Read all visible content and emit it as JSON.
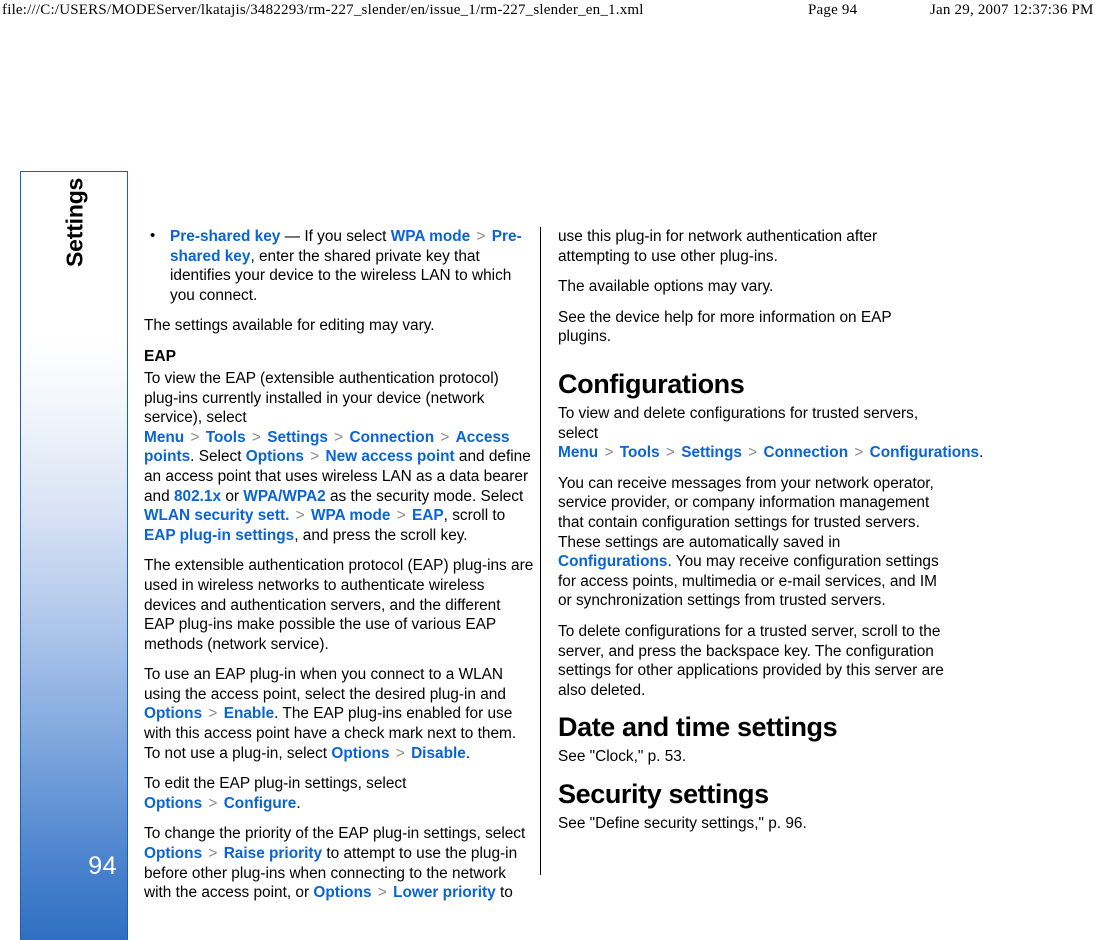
{
  "print_header": {
    "url": "file:///C:/USERS/MODEServer/lkatajis/3482293/rm-227_slender/en/issue_1/rm-227_slender_en_1.xml",
    "page_label": "Page 94",
    "timestamp": "Jan 29, 2007 12:37:36 PM"
  },
  "chapter_tab": {
    "label": "Settings",
    "page_number": "94",
    "border_color": "#1a5fa8",
    "gradient_bottom_color": "#2f6fc2"
  },
  "colors": {
    "link_blue": "#0a64d4",
    "arrow_grey": "#8b8b8b",
    "text_black": "#000000"
  },
  "left_column": {
    "bullet_items": [
      {
        "segments": [
          {
            "t": "Pre-shared key",
            "s": "ui"
          },
          {
            "t": " — If you select ",
            "s": "plain"
          },
          {
            "t": "WPA mode",
            "s": "ui"
          },
          {
            "t": ">",
            "s": "arrow"
          },
          {
            "t": "Pre-shared key",
            "s": "ui"
          },
          {
            "t": ", enter the shared private key that identifies your device to the wireless LAN to which you connect.",
            "s": "plain"
          }
        ]
      }
    ],
    "paragraph_1": "The settings available for editing may vary.",
    "heading_eap": "EAP",
    "paragraph_eap_1": {
      "segments": [
        {
          "t": "To view the EAP (extensible authentication protocol) plug-ins currently installed in your device (network service), select ",
          "s": "plain"
        },
        {
          "t": "Menu",
          "s": "ui"
        },
        {
          "t": ">",
          "s": "arrow"
        },
        {
          "t": "Tools",
          "s": "ui"
        },
        {
          "t": ">",
          "s": "arrow"
        },
        {
          "t": "Settings",
          "s": "ui"
        },
        {
          "t": ">",
          "s": "arrow"
        },
        {
          "t": "Connection",
          "s": "ui"
        },
        {
          "t": ">",
          "s": "arrow"
        },
        {
          "t": "Access points",
          "s": "ui"
        },
        {
          "t": ". Select ",
          "s": "plain"
        },
        {
          "t": "Options",
          "s": "ui"
        },
        {
          "t": ">",
          "s": "arrow"
        },
        {
          "t": "New access point",
          "s": "ui"
        },
        {
          "t": " and define an access point that uses wireless LAN as a data bearer and ",
          "s": "plain"
        },
        {
          "t": "802.1x",
          "s": "ui"
        },
        {
          "t": " or ",
          "s": "plain"
        },
        {
          "t": "WPA/WPA2",
          "s": "ui"
        },
        {
          "t": " as the security mode. Select ",
          "s": "plain"
        },
        {
          "t": "WLAN security sett.",
          "s": "ui"
        },
        {
          "t": ">",
          "s": "arrow"
        },
        {
          "t": "WPA mode",
          "s": "ui"
        },
        {
          "t": ">",
          "s": "arrow"
        },
        {
          "t": "EAP",
          "s": "ui"
        },
        {
          "t": ", scroll to ",
          "s": "plain"
        },
        {
          "t": "EAP plug-in settings",
          "s": "ui"
        },
        {
          "t": ", and press the scroll key.",
          "s": "plain"
        }
      ]
    },
    "paragraph_eap_2": "The extensible authentication protocol (EAP) plug-ins are used in wireless networks to authenticate wireless devices and authentication servers, and the different EAP plug-ins make possible the use of various EAP methods (network service).",
    "paragraph_eap_3": {
      "segments": [
        {
          "t": "To use an EAP plug-in when you connect to a WLAN using the access point, select the desired plug-in and ",
          "s": "plain"
        },
        {
          "t": "Options",
          "s": "ui"
        },
        {
          "t": ">",
          "s": "arrow"
        },
        {
          "t": "Enable",
          "s": "ui"
        },
        {
          "t": ". The EAP plug-ins enabled for use with this access point have a check mark next to them. To not use a plug-in, select ",
          "s": "plain"
        },
        {
          "t": "Options",
          "s": "ui"
        },
        {
          "t": ">",
          "s": "arrow"
        },
        {
          "t": "Disable",
          "s": "ui"
        },
        {
          "t": ".",
          "s": "plain"
        }
      ]
    },
    "paragraph_eap_4": {
      "segments": [
        {
          "t": "To edit the EAP plug-in settings, select ",
          "s": "plain"
        },
        {
          "t": "Options",
          "s": "ui"
        },
        {
          "t": ">",
          "s": "arrow"
        },
        {
          "t": "Configure",
          "s": "ui"
        },
        {
          "t": ".",
          "s": "plain"
        }
      ]
    },
    "paragraph_eap_5": {
      "segments": [
        {
          "t": "To change the priority of the EAP plug-in settings, select ",
          "s": "plain"
        },
        {
          "t": "Options",
          "s": "ui"
        },
        {
          "t": ">",
          "s": "arrow"
        },
        {
          "t": "Raise priority",
          "s": "ui"
        },
        {
          "t": " to attempt to use the plug-in before other plug-ins when connecting to the network with the access point, or ",
          "s": "plain"
        },
        {
          "t": "Options",
          "s": "ui"
        },
        {
          "t": ">",
          "s": "arrow"
        },
        {
          "t": "Lower priority",
          "s": "ui"
        },
        {
          "t": " to",
          "s": "plain"
        }
      ]
    }
  },
  "right_column": {
    "paragraph_cont": "use this plug-in for network authentication after attempting to use other plug-ins.",
    "paragraph_1": "The available options may vary.",
    "paragraph_2": "See the device help for more information on EAP plugins.",
    "heading_configurations": "Configurations",
    "paragraph_conf_1": {
      "segments": [
        {
          "t": "To view and delete configurations for trusted servers, select ",
          "s": "plain"
        },
        {
          "t": "Menu",
          "s": "ui"
        },
        {
          "t": ">",
          "s": "arrow"
        },
        {
          "t": "Tools",
          "s": "ui"
        },
        {
          "t": ">",
          "s": "arrow"
        },
        {
          "t": "Settings",
          "s": "ui"
        },
        {
          "t": ">",
          "s": "arrow"
        },
        {
          "t": "Connection",
          "s": "ui"
        },
        {
          "t": ">",
          "s": "arrow"
        },
        {
          "t": "Configurations",
          "s": "ui"
        },
        {
          "t": ".",
          "s": "plain"
        }
      ]
    },
    "paragraph_conf_2": {
      "segments": [
        {
          "t": "You can receive messages from your network operator, service provider, or company information management that contain configuration settings for trusted servers. These settings are automatically saved in ",
          "s": "plain"
        },
        {
          "t": "Configurations",
          "s": "ui"
        },
        {
          "t": ". You may receive configuration settings for access points, multimedia or e-mail services, and IM or synchronization settings from trusted servers.",
          "s": "plain"
        }
      ]
    },
    "paragraph_conf_3": "To delete configurations for a trusted server, scroll to the server, and press the backspace key. The configuration settings for other applications provided by this server are also deleted.",
    "heading_date_time": "Date and time settings",
    "paragraph_date_time": "See \"Clock,\" p. 53.",
    "heading_security": "Security settings",
    "paragraph_security": "See \"Define security settings,\" p. 96."
  }
}
